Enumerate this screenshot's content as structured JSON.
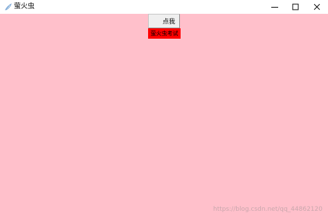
{
  "window": {
    "title": "萤火虫",
    "background_color": "#ffc0cb",
    "icons": {
      "app": "feather-icon",
      "minimize": "minimize-icon",
      "maximize": "maximize-icon",
      "close": "close-icon"
    }
  },
  "content": {
    "button_label": "点我",
    "label_text": "萤火虫考试",
    "label_color": "#ff0000"
  },
  "watermark": "https://blog.csdn.net/qq_44862120"
}
